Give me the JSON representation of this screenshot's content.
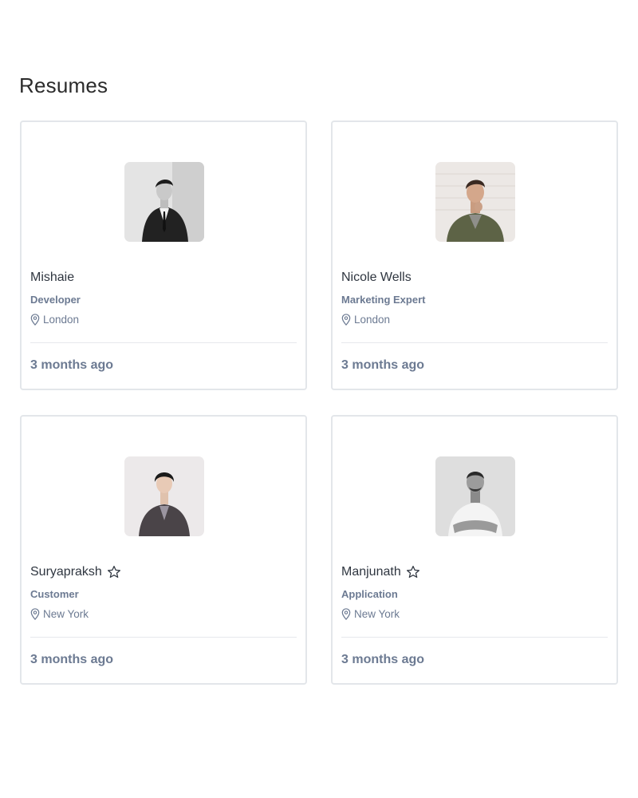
{
  "page": {
    "title": "Resumes"
  },
  "resumes": [
    {
      "name": "Mishaie",
      "role": "Developer",
      "location": "London",
      "posted": "3 months ago",
      "starred": false,
      "avatar_icon": "person-photo-icon",
      "avatar_bg": "#d8d8d8"
    },
    {
      "name": "Nicole Wells",
      "role": "Marketing Expert",
      "location": "London",
      "posted": "3 months ago",
      "starred": false,
      "avatar_icon": "person-photo-icon",
      "avatar_bg": "#e9e3df"
    },
    {
      "name": "Suryapraksh",
      "role": "Customer",
      "location": "New York",
      "posted": "3 months ago",
      "starred": true,
      "avatar_icon": "person-photo-icon",
      "avatar_bg": "#ebe8ea"
    },
    {
      "name": "Manjunath",
      "role": "Application",
      "location": "New York",
      "posted": "3 months ago",
      "starred": true,
      "avatar_icon": "person-photo-icon",
      "avatar_bg": "#dcdcdc"
    }
  ],
  "colors": {
    "text": "#2f3640",
    "muted": "#6c7a92",
    "border": "#e3e6ea"
  }
}
